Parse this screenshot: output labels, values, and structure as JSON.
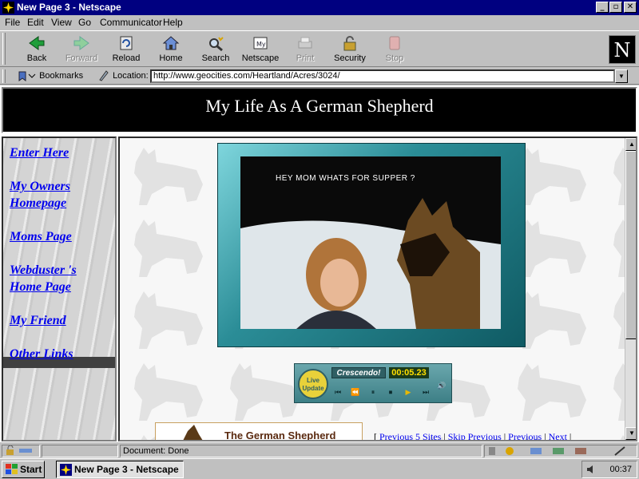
{
  "window": {
    "title": "New Page 3 - Netscape",
    "controls": {
      "minimize": "_",
      "maximize": "▫",
      "close": "✕"
    }
  },
  "menu": [
    {
      "label": "File",
      "key": "F"
    },
    {
      "label": "Edit",
      "key": "E"
    },
    {
      "label": "View",
      "key": "V"
    },
    {
      "label": "Go",
      "key": "G"
    },
    {
      "label": "Communicator",
      "key": "C"
    },
    {
      "label": "Help",
      "key": "H"
    }
  ],
  "toolbar": {
    "back": "Back",
    "forward": "Forward",
    "reload": "Reload",
    "home": "Home",
    "search": "Search",
    "netscape": "Netscape",
    "print": "Print",
    "security": "Security",
    "stop": "Stop",
    "logo": "N"
  },
  "location_bar": {
    "bookmarks_label": "Bookmarks",
    "location_label": "Location:",
    "url": "http://www.geocities.com/Heartland/Acres/3024/"
  },
  "page": {
    "banner_title": "My Life As A German Shepherd",
    "nav_links": [
      "Enter Here",
      "My Owners Homepage",
      "Moms Page",
      "Webduster 's Home Page",
      "My Friend",
      "Other Links"
    ],
    "photo_caption": "HEY MOM WHATS FOR SUPPER ?",
    "player": {
      "title": "Crescendo!",
      "time": "00:05.23",
      "badge": "Live Update"
    },
    "preview_title": "The German Shepherd",
    "ring_links": {
      "prev5": "Previous 5 Sites",
      "skip_prev": "Skip Previous",
      "previous": "Previous",
      "next": "Next"
    }
  },
  "status": {
    "text": "Document: Done"
  },
  "taskbar": {
    "start": "Start",
    "task": "New Page 3 - Netscape",
    "clock": "00:37"
  },
  "colors": {
    "titlebar": "#000080",
    "link": "#0000ee",
    "banner_bg": "#000000",
    "frame_teal": "#2b8d97"
  }
}
